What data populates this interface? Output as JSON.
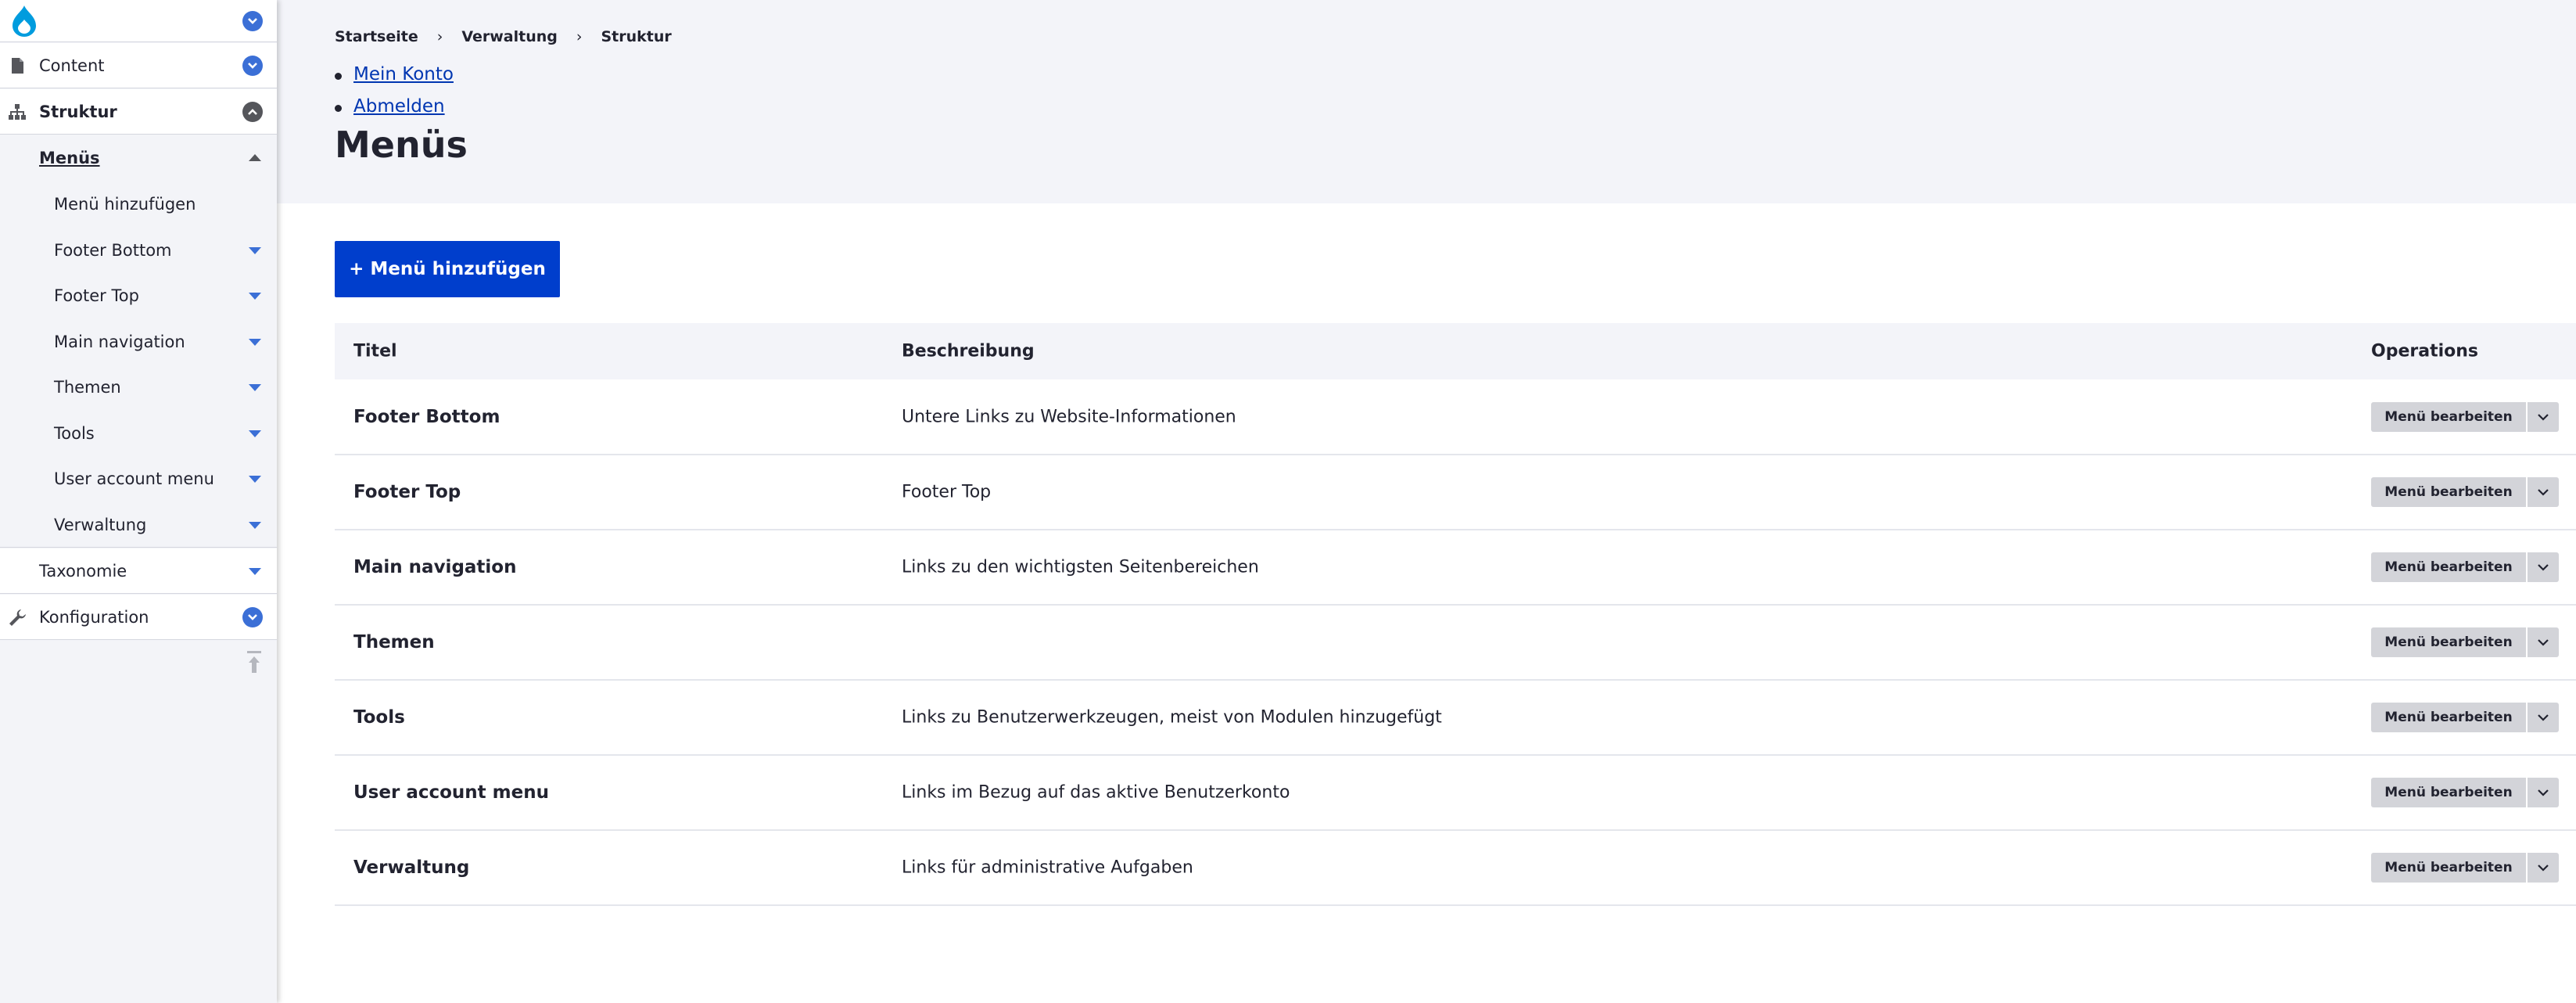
{
  "sidebar": {
    "items": [
      {
        "label": "Content"
      },
      {
        "label": "Struktur"
      },
      {
        "label": "Menüs"
      },
      {
        "label": "Menü hinzufügen"
      },
      {
        "label": "Footer Bottom"
      },
      {
        "label": "Footer Top"
      },
      {
        "label": "Main navigation"
      },
      {
        "label": "Themen"
      },
      {
        "label": "Tools"
      },
      {
        "label": "User account menu"
      },
      {
        "label": "Verwaltung"
      },
      {
        "label": "Taxonomie"
      },
      {
        "label": "Konfiguration"
      }
    ]
  },
  "breadcrumb": [
    "Startseite",
    "Verwaltung",
    "Struktur"
  ],
  "breadcrumb_sep": "›",
  "user_links": [
    "Mein Konto",
    "Abmelden"
  ],
  "page_title": "Menüs",
  "add_button": "+ Menü hinzufügen",
  "table": {
    "headers": [
      "Titel",
      "Beschreibung",
      "Operations"
    ],
    "rows": [
      {
        "title": "Footer Bottom",
        "description": "Untere Links zu Website-Informationen",
        "op": "Menü bearbeiten"
      },
      {
        "title": "Footer Top",
        "description": "Footer Top",
        "op": "Menü bearbeiten"
      },
      {
        "title": "Main navigation",
        "description": "Links zu den wichtigsten Seitenbereichen",
        "op": "Menü bearbeiten"
      },
      {
        "title": "Themen",
        "description": "",
        "op": "Menü bearbeiten"
      },
      {
        "title": "Tools",
        "description": "Links zu Benutzerwerkzeugen, meist von Modulen hinzugefügt",
        "op": "Menü bearbeiten"
      },
      {
        "title": "User account menu",
        "description": "Links im Bezug auf das aktive Benutzerkonto",
        "op": "Menü bearbeiten"
      },
      {
        "title": "Verwaltung",
        "description": "Links für administrative Aufgaben",
        "op": "Menü bearbeiten"
      }
    ]
  },
  "colors": {
    "primary": "#003ecc",
    "link": "#0036b1",
    "toggle": "#3b6fd6"
  },
  "icons": [
    "drupal-logo-icon",
    "chevron-down-icon",
    "document-icon",
    "sitemap-icon",
    "chevron-up-icon",
    "wrench-icon",
    "pin-icon"
  ]
}
